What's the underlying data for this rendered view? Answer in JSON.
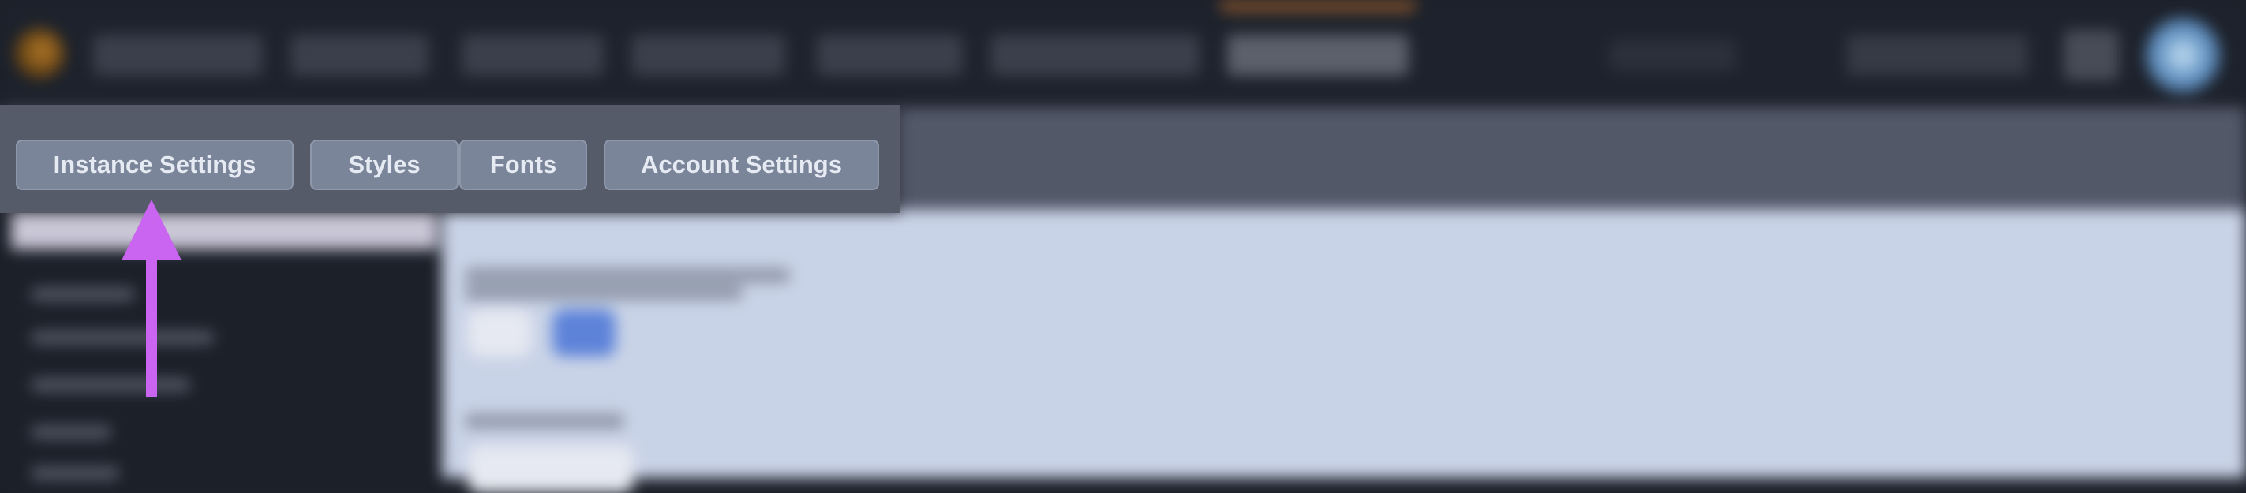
{
  "tabs": [
    {
      "label": "Instance Settings"
    },
    {
      "label": "Styles"
    },
    {
      "label": "Fonts"
    },
    {
      "label": "Account Settings"
    }
  ],
  "colors": {
    "tab_bar_bg": "#555b69",
    "tab_bg": "#7a859a",
    "tab_text": "#e6eaf2",
    "arrow": "#c965f0",
    "content_bg": "#c9d3e7",
    "topbar_bg": "#1d222c"
  },
  "icons": {
    "logo": "app-logo-icon",
    "avatar": "user-avatar-icon",
    "arrow": "arrow-up-icon"
  }
}
